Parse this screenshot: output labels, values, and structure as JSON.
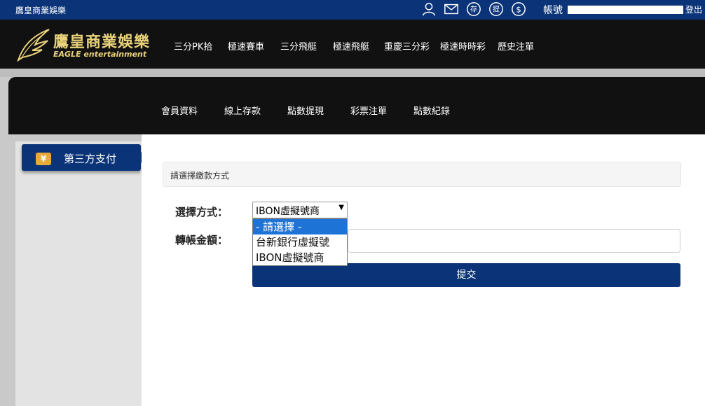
{
  "topbar": {
    "site_name": "鷹皇商業娛樂",
    "icons": [
      "user-icon",
      "mail-icon",
      "deposit-icon",
      "withdraw-icon",
      "dollar-icon"
    ],
    "icon_glyphs": {
      "deposit": "存",
      "withdraw": "提",
      "dollar": "$"
    },
    "account_label": "帳號",
    "logout_label": "登出"
  },
  "logo": {
    "cn": "鷹皇商業娛樂",
    "en": "EAGLE entertainment"
  },
  "nav": [
    "三分PK拾",
    "極速賽車",
    "三分飛艇",
    "極速飛艇",
    "重慶三分彩",
    "極速時時彩",
    "歷史注單"
  ],
  "subnav": [
    "會員資料",
    "線上存款",
    "點數提現",
    "彩票注單",
    "點數紀錄"
  ],
  "sidebar": {
    "active_tab": "第三方支付",
    "tab_icon": "¥"
  },
  "form": {
    "hint": "請選擇繳款方式",
    "method_label": "選擇方式：",
    "method_value": "IBON虛擬號商",
    "method_options": [
      "- 請選擇 -",
      "台新銀行虛擬號",
      "IBON虛擬號商"
    ],
    "highlighted_option": "- 請選擇 -",
    "amount_label": "轉帳金額：",
    "amount_value": "",
    "submit_label": "提交"
  },
  "colors": {
    "brand_blue": "#0b3478",
    "gold": "#e9d27a",
    "dark": "#111111"
  }
}
